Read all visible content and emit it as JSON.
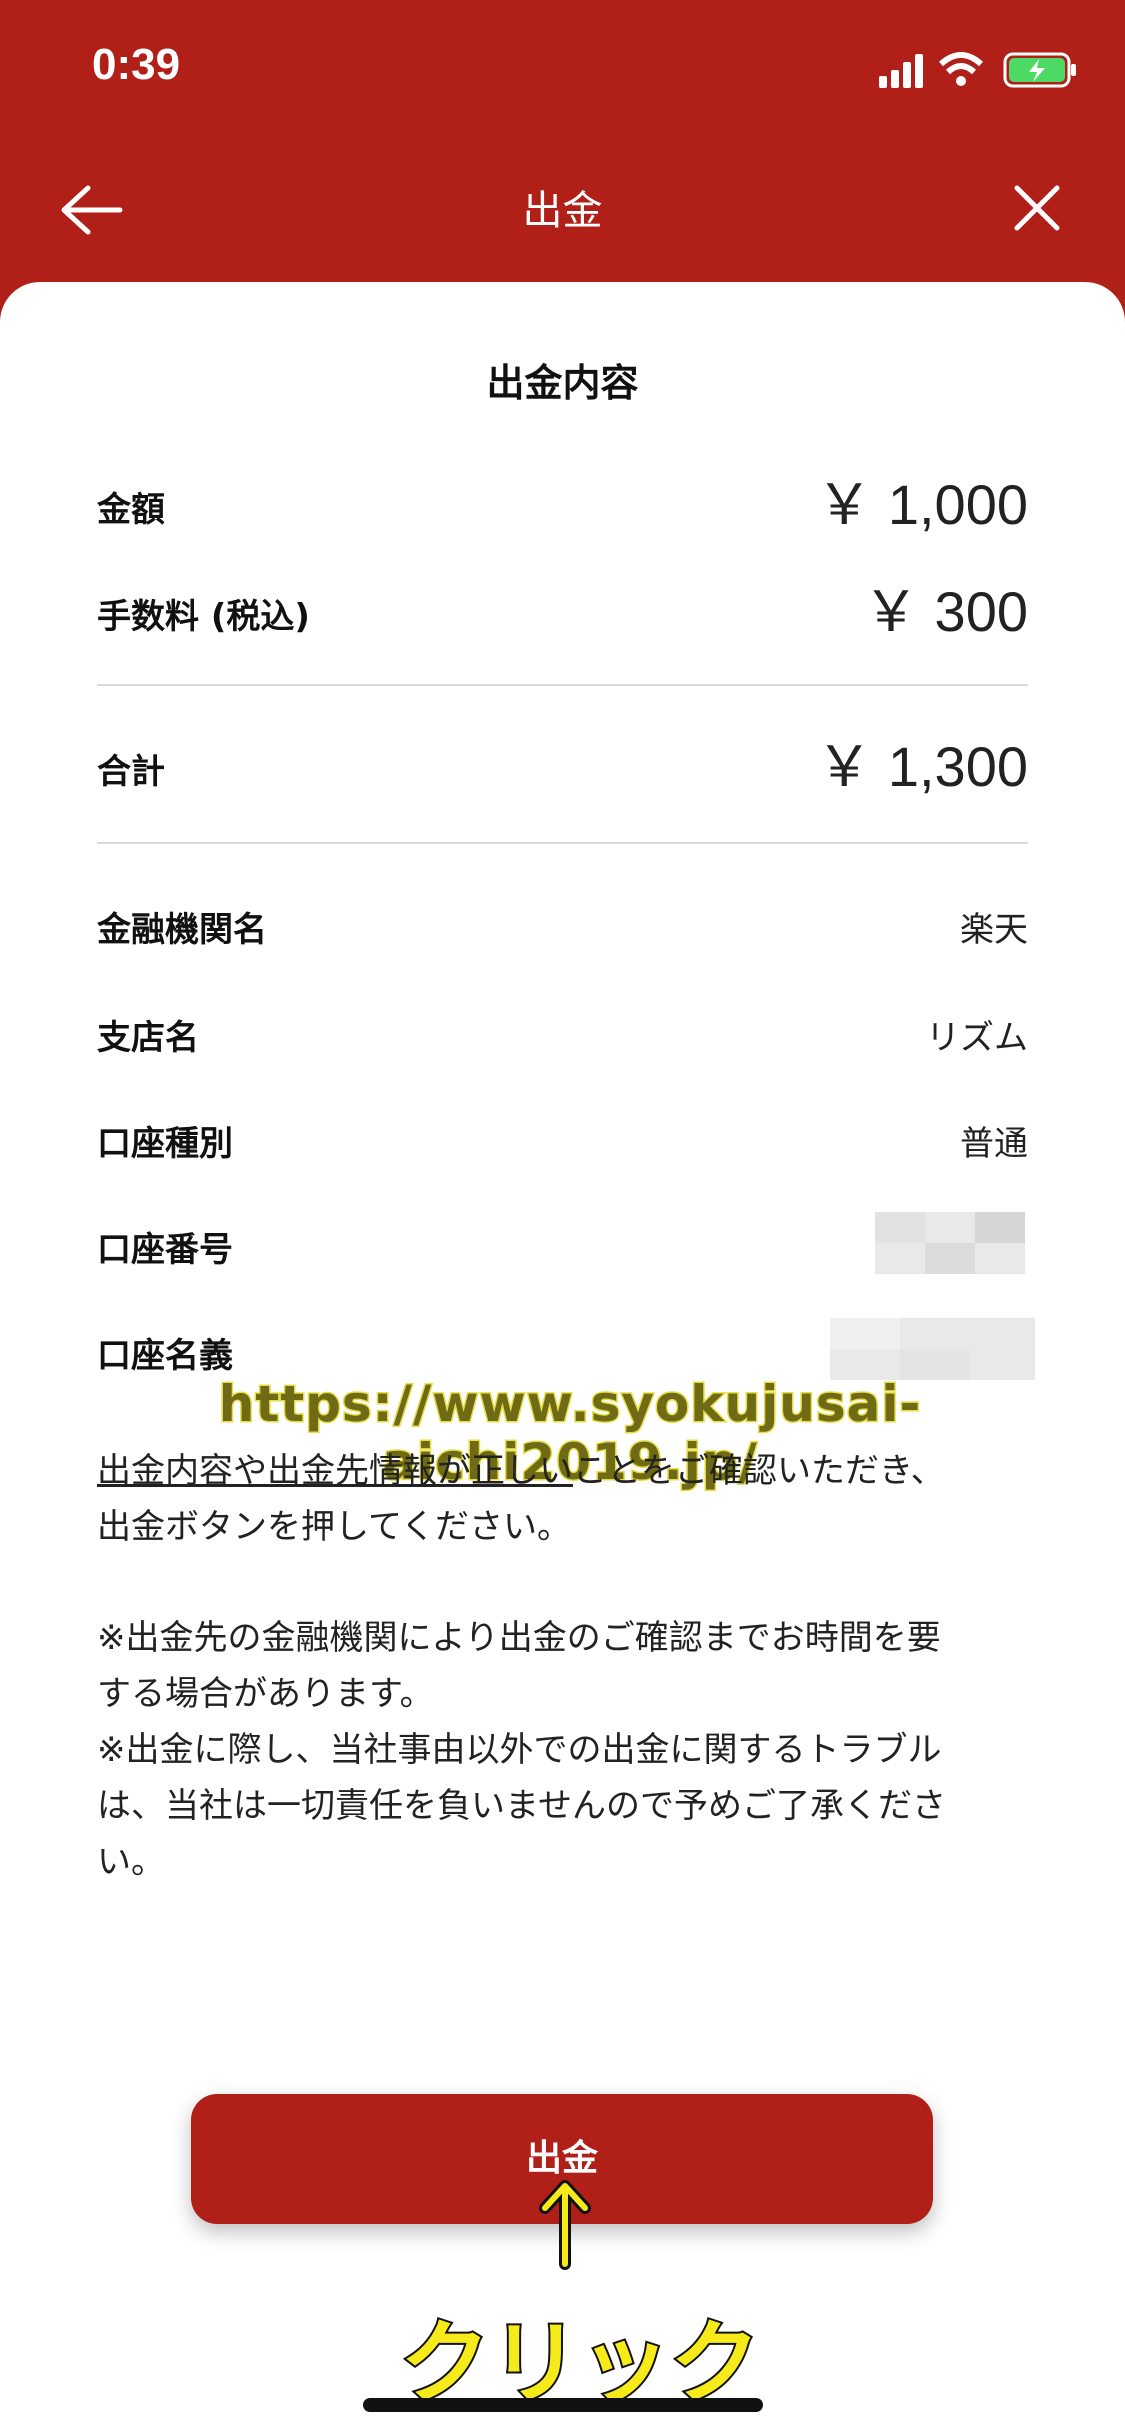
{
  "status_bar": {
    "time": "0:39"
  },
  "nav": {
    "title": "出金"
  },
  "section_title": "出金内容",
  "amounts": {
    "amount_label": "金額",
    "amount_value": "￥ 1,000",
    "fee_label": "手数料 (税込)",
    "fee_value": "￥ 300",
    "total_label": "合計",
    "total_value": "￥ 1,300"
  },
  "bank": {
    "institution_label": "金融機関名",
    "institution_value": "楽天",
    "branch_label": "支店名",
    "branch_value": "リズム",
    "type_label": "口座種別",
    "type_value": "普通",
    "number_label": "口座番号",
    "holder_label": "口座名義"
  },
  "watermark": "https://www.syokujusai-aichi2019.jp/",
  "notice": {
    "line1_underlined": "出金内容や出金先情報が正しい",
    "line1_rest": "ことをご確認いただき、",
    "line2": "出金ボタンを押してください。"
  },
  "notes": {
    "n1a": "※出金先の金融機関により出金のご確認までお時間を要",
    "n1b": "する場合があります。",
    "n2a": "※出金に際し、当社事由以外での出金に関するトラブル",
    "n2b": "は、当社は一切責任を負いませんので予めご了承くださ",
    "n2c": "い。"
  },
  "button": {
    "label": "出金"
  },
  "annotation": {
    "click": "クリック"
  },
  "colors": {
    "brand_red": "#b02019",
    "highlight_yellow": "#f6ea1a"
  }
}
